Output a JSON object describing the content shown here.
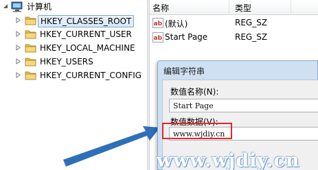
{
  "tree": {
    "root_label": "计算机",
    "items": [
      {
        "label": "HKEY_CLASSES_ROOT",
        "selected": true
      },
      {
        "label": "HKEY_CURRENT_USER",
        "selected": false
      },
      {
        "label": "HKEY_LOCAL_MACHINE",
        "selected": false
      },
      {
        "label": "HKEY_USERS",
        "selected": false
      },
      {
        "label": "HKEY_CURRENT_CONFIG",
        "selected": false
      }
    ]
  },
  "list": {
    "col_name": "名称",
    "col_type": "类型",
    "rows": [
      {
        "name": "(默认)",
        "type": "REG_SZ",
        "icon": "string-value-icon"
      },
      {
        "name": "Start Page",
        "type": "REG_SZ",
        "icon": "string-value-icon"
      }
    ]
  },
  "dialog": {
    "title": "编辑字符串",
    "name_label": "数值名称(N):",
    "name_value": "Start Page",
    "data_label": "数值数据(V):",
    "data_value": "www.wjdiy.cn"
  },
  "watermark": "www.wjdiy.cn",
  "colors": {
    "highlight": "#e3262b",
    "arrow": "#2f6fb8",
    "selection_border": "#7da2ce"
  }
}
